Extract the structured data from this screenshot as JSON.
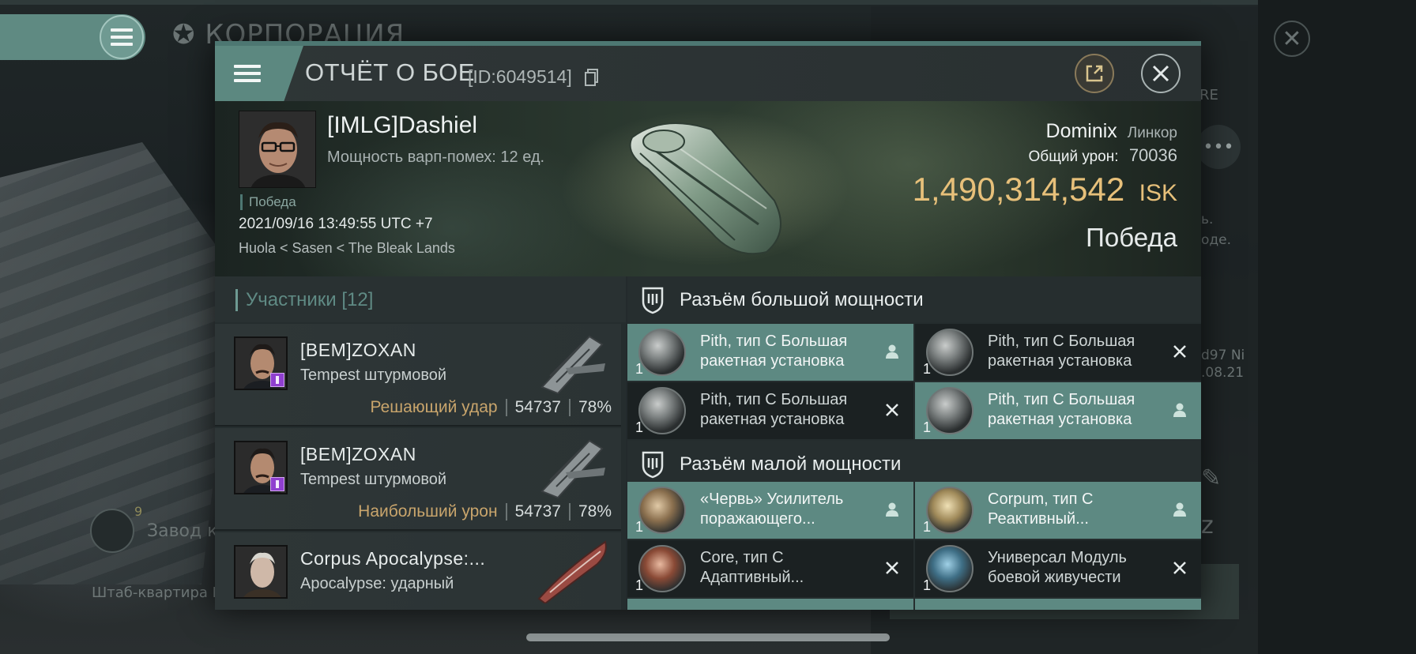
{
  "background": {
    "title": "КОРПОРАЦИЯ",
    "right_label": "RE",
    "right_text_1": "ь.",
    "right_text_2": "оде.",
    "right_text_3": "d97 Ni",
    "right_text_4": ".08.21",
    "factory_count": "9",
    "factory_label": "Завод к",
    "hq_label": "Штаб-квартира N"
  },
  "header": {
    "title": "ОТЧЁТ О БОЕ",
    "id": "[ID:6049514]"
  },
  "hero": {
    "pilot_name": "[IMLG]Dashiel",
    "warp_scramble": "Мощность варп-помех: 12 ед.",
    "victory_tag": "Победа",
    "timestamp": "2021/09/16 13:49:55 UTC +7",
    "location": "Huola < Sasen < The Bleak Lands",
    "ship": "Dominix",
    "ship_class": "Линкор",
    "damage_label": "Общий урон:",
    "damage_value": "70036",
    "isk_amount": "1,490,314,542",
    "isk_currency": "ISK",
    "result": "Победа"
  },
  "participants": {
    "header": "Участники [12]",
    "rows": [
      {
        "name": "[BEM]ZOXAN",
        "ship": "Tempest штурмовой",
        "tag": "Решающий удар",
        "damage": "54737",
        "percent": "78%"
      },
      {
        "name": "[BEM]ZOXAN",
        "ship": "Tempest штурмовой",
        "tag": "Наибольший урон",
        "damage": "54737",
        "percent": "78%"
      },
      {
        "name": "Corpus Apocalypse:...",
        "ship": "Apocalypse: ударный",
        "tag": "",
        "damage": "",
        "percent": ""
      }
    ]
  },
  "slots": {
    "high_header": "Разъём большой мощности",
    "high": [
      {
        "name": "Pith, тип C Большая ракетная установка",
        "qty": "1",
        "state": "on"
      },
      {
        "name": "Pith, тип C Большая ракетная установка",
        "qty": "1",
        "state": "off"
      },
      {
        "name": "Pith, тип C Большая ракетная установка",
        "qty": "1",
        "state": "off"
      },
      {
        "name": "Pith, тип C Большая ракетная установка",
        "qty": "1",
        "state": "on"
      }
    ],
    "mid_header": "Разъём малой мощности",
    "mid": [
      {
        "name": "«Червь» Усилитель поражающего...",
        "qty": "1",
        "state": "on"
      },
      {
        "name": "Corpum, тип C Реактивный...",
        "qty": "1",
        "state": "on"
      },
      {
        "name": "Core, тип C Адаптивный...",
        "qty": "1",
        "state": "off"
      },
      {
        "name": "Универсал Модуль боевой живучести",
        "qty": "1",
        "state": "off"
      }
    ]
  },
  "colors": {
    "accent": "#5d8982",
    "isk": "#e7c07a",
    "tag": "#c9a56c"
  }
}
